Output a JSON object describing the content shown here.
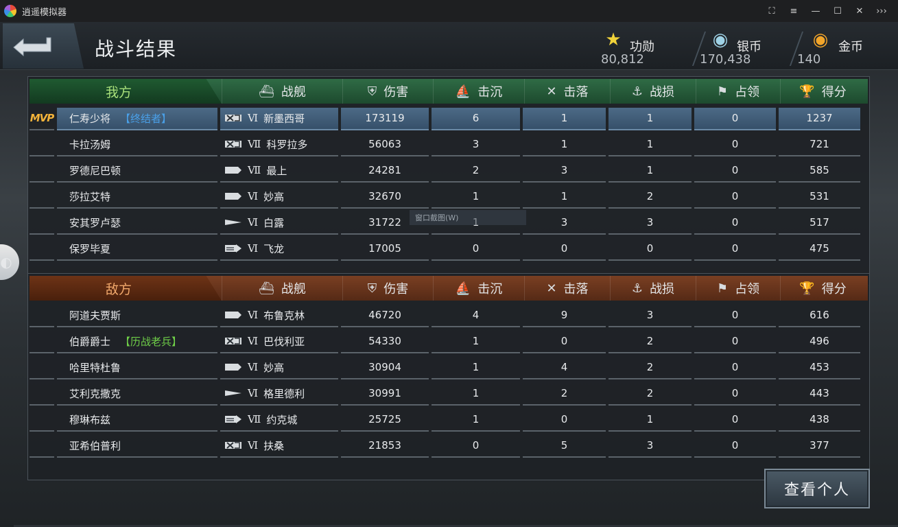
{
  "window": {
    "title": "逍遥模拟器",
    "controls": [
      "⛶",
      "≡",
      "—",
      "☐",
      "✕",
      "›››"
    ]
  },
  "header": {
    "title": "战斗结果",
    "currencies": [
      {
        "icon": "star-plus-icon",
        "glyph": "★",
        "color": "#f1d33a",
        "label": "功勋",
        "value": "80,812"
      },
      {
        "icon": "silver-coin-icon",
        "glyph": "◉",
        "color": "#9fd2e6",
        "label": "银币",
        "value": "170,438"
      },
      {
        "icon": "gold-coin-icon",
        "glyph": "◉",
        "color": "#f2a52a",
        "label": "金币",
        "value": "140"
      }
    ]
  },
  "columns": {
    "ship": "战舰",
    "damage": "伤害",
    "sunk": "击沉",
    "shot_down": "击落",
    "losses": "战损",
    "capture": "占领",
    "score": "得分"
  },
  "ours": {
    "label": "我方",
    "rows": [
      {
        "mvp": "MVP",
        "name": "仁寿少将",
        "tag": "【终结者】",
        "tag_color": "#4aa0e8",
        "ship_type": "carrier",
        "tier": "Ⅵ",
        "ship": "新墨西哥",
        "damage": "173119",
        "sunk": "6",
        "shot_down": "1",
        "losses": "1",
        "capture": "0",
        "score": "1237"
      },
      {
        "mvp": "",
        "name": "卡拉汤姆",
        "tag": "",
        "tag_color": "",
        "ship_type": "carrier",
        "tier": "Ⅶ",
        "ship": "科罗拉多",
        "damage": "56063",
        "sunk": "3",
        "shot_down": "1",
        "losses": "1",
        "capture": "0",
        "score": "721"
      },
      {
        "mvp": "",
        "name": "罗德尼巴顿",
        "tag": "",
        "tag_color": "",
        "ship_type": "cruiser",
        "tier": "Ⅶ",
        "ship": "最上",
        "damage": "24281",
        "sunk": "2",
        "shot_down": "3",
        "losses": "1",
        "capture": "0",
        "score": "585"
      },
      {
        "mvp": "",
        "name": "莎拉艾特",
        "tag": "",
        "tag_color": "",
        "ship_type": "cruiser",
        "tier": "Ⅵ",
        "ship": "妙高",
        "damage": "32670",
        "sunk": "1",
        "shot_down": "1",
        "losses": "2",
        "capture": "0",
        "score": "531"
      },
      {
        "mvp": "",
        "name": "安其罗卢瑟",
        "tag": "",
        "tag_color": "",
        "ship_type": "destroyer",
        "tier": "Ⅵ",
        "ship": "白露",
        "damage": "31722",
        "sunk": "1",
        "shot_down": "3",
        "losses": "3",
        "capture": "0",
        "score": "517"
      },
      {
        "mvp": "",
        "name": "保罗毕夏",
        "tag": "",
        "tag_color": "",
        "ship_type": "aircraft",
        "tier": "Ⅵ",
        "ship": "飞龙",
        "damage": "17005",
        "sunk": "0",
        "shot_down": "0",
        "losses": "0",
        "capture": "0",
        "score": "475"
      }
    ]
  },
  "enemy": {
    "label": "敌方",
    "rows": [
      {
        "mvp": "",
        "name": "阿道夫贾斯",
        "tag": "",
        "tag_color": "",
        "ship_type": "cruiser",
        "tier": "Ⅵ",
        "ship": "布鲁克林",
        "damage": "46720",
        "sunk": "4",
        "shot_down": "9",
        "losses": "3",
        "capture": "0",
        "score": "616"
      },
      {
        "mvp": "",
        "name": "伯爵爵士",
        "tag": "【历战老兵】",
        "tag_color": "#6fcf48",
        "ship_type": "carrier",
        "tier": "Ⅵ",
        "ship": "巴伐利亚",
        "damage": "54330",
        "sunk": "1",
        "shot_down": "0",
        "losses": "2",
        "capture": "0",
        "score": "496"
      },
      {
        "mvp": "",
        "name": "哈里特杜鲁",
        "tag": "",
        "tag_color": "",
        "ship_type": "cruiser",
        "tier": "Ⅵ",
        "ship": "妙高",
        "damage": "30904",
        "sunk": "1",
        "shot_down": "4",
        "losses": "2",
        "capture": "0",
        "score": "453"
      },
      {
        "mvp": "",
        "name": "艾利克撒克",
        "tag": "",
        "tag_color": "",
        "ship_type": "destroyer",
        "tier": "Ⅵ",
        "ship": "格里德利",
        "damage": "30991",
        "sunk": "1",
        "shot_down": "2",
        "losses": "2",
        "capture": "0",
        "score": "443"
      },
      {
        "mvp": "",
        "name": "穆琳布兹",
        "tag": "",
        "tag_color": "",
        "ship_type": "aircraft",
        "tier": "Ⅶ",
        "ship": "约克城",
        "damage": "25725",
        "sunk": "1",
        "shot_down": "0",
        "losses": "1",
        "capture": "0",
        "score": "438"
      },
      {
        "mvp": "",
        "name": "亚希伯普利",
        "tag": "",
        "tag_color": "",
        "ship_type": "carrier",
        "tier": "Ⅵ",
        "ship": "扶桑",
        "damage": "21853",
        "sunk": "0",
        "shot_down": "5",
        "losses": "3",
        "capture": "0",
        "score": "377"
      }
    ]
  },
  "ghost_tooltip": "窗口截图(W)",
  "view_button": "查看个人"
}
